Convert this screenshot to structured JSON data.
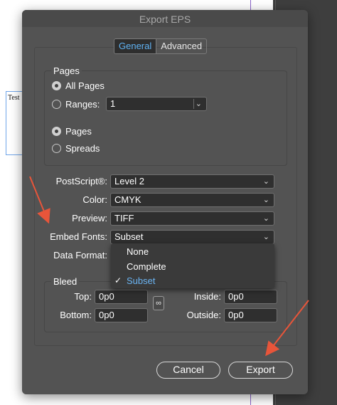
{
  "dialog": {
    "title": "Export EPS"
  },
  "tabs": [
    {
      "label": "General"
    },
    {
      "label": "Advanced"
    }
  ],
  "pages": {
    "title": "Pages",
    "all_pages": "All Pages",
    "ranges": "Ranges:",
    "ranges_value": "1",
    "pages_option": "Pages",
    "spreads_option": "Spreads"
  },
  "settings": {
    "postscript_label": "PostScript®:",
    "postscript_value": "Level 2",
    "color_label": "Color:",
    "color_value": "CMYK",
    "preview_label": "Preview:",
    "preview_value": "TIFF",
    "embed_fonts_label": "Embed Fonts:",
    "embed_fonts_value": "Subset",
    "data_format_label": "Data Format:"
  },
  "embed_fonts_options": [
    {
      "label": "None",
      "selected": false
    },
    {
      "label": "Complete",
      "selected": false
    },
    {
      "label": "Subset",
      "selected": true
    }
  ],
  "bleed": {
    "title": "Bleed",
    "top_label": "Top:",
    "top_value": "0p0",
    "bottom_label": "Bottom:",
    "bottom_value": "0p0",
    "inside_label": "Inside:",
    "inside_value": "0p0",
    "outside_label": "Outside:",
    "outside_value": "0p0"
  },
  "buttons": {
    "cancel": "Cancel",
    "export": "Export"
  },
  "background_doc": {
    "text": "Test"
  },
  "colors": {
    "dialog_bg": "#535353",
    "accent_blue": "#5fb2f3",
    "annotation_arrow": "#e8553a"
  }
}
